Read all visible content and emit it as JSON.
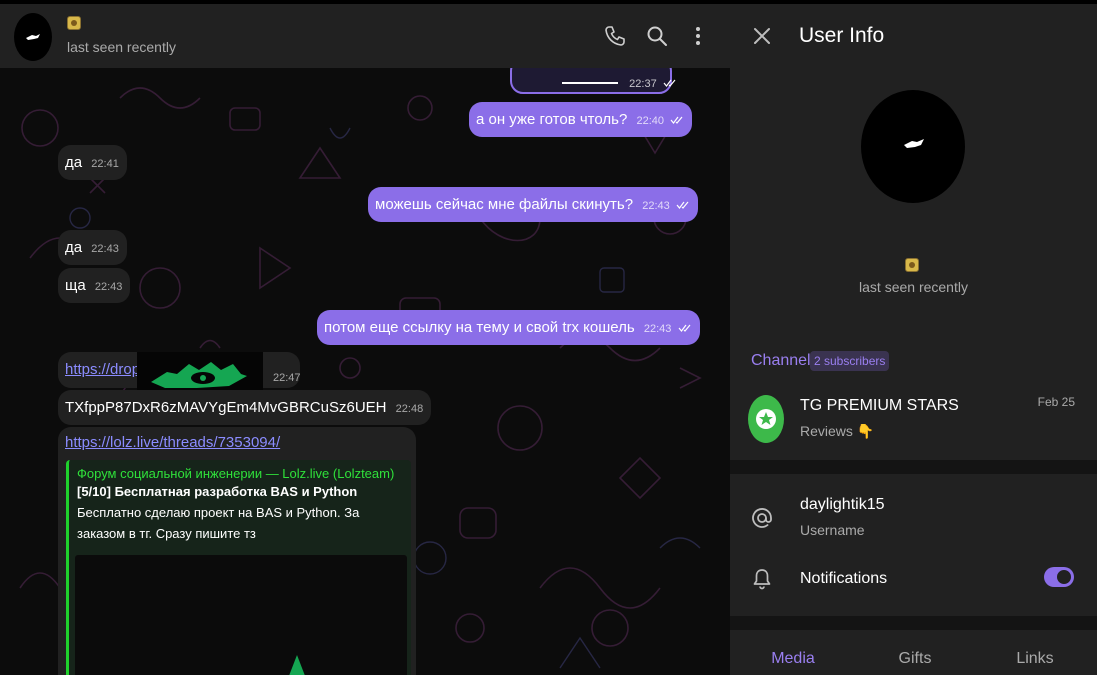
{
  "header": {
    "status": "last seen recently"
  },
  "messages": [
    {
      "dir": "out",
      "text": "",
      "time": "22:37"
    },
    {
      "dir": "out",
      "text": "а он уже готов чтоль?",
      "time": "22:40"
    },
    {
      "dir": "in",
      "text": "да",
      "time": "22:41"
    },
    {
      "dir": "out",
      "text": "можешь сейчас мне файлы скинуть?",
      "time": "22:43"
    },
    {
      "dir": "in",
      "text": "да",
      "time": "22:43"
    },
    {
      "dir": "in",
      "text": "ща",
      "time": "22:43"
    },
    {
      "dir": "out",
      "text": "потом еще ссылку на тему и свой trx кошель",
      "time": "22:43"
    },
    {
      "dir": "in",
      "text": "https://drop",
      "time": "22:47"
    },
    {
      "dir": "in",
      "text": "TXfppP87DxR6zMAVYgEm4MvGBRCuSz6UEH",
      "time": "22:48"
    },
    {
      "dir": "in",
      "text": "https://lolz.live/threads/7353094/",
      "time": ""
    }
  ],
  "link_preview": {
    "site": "Форум социальной инженерии —  Lolz.live (Lolzteam)",
    "title": "[5/10] Бесплатная разработка BAS и Python",
    "description": "Бесплатно сделаю проект на BAS и Python. За заказом в тг. Сразу пишите тз"
  },
  "info_panel": {
    "title": "User Info",
    "status": "last seen recently",
    "channel_label": "Channel",
    "channel_badge": "2 subscribers",
    "channel_name": "TG PREMIUM STARS",
    "channel_sub": "Reviews 👇",
    "channel_date": "Feb 25",
    "username": "daylightik15",
    "username_label": "Username",
    "notifications_label": "Notifications",
    "notifications_on": true,
    "tabs": [
      "Media",
      "Gifts",
      "Links"
    ],
    "active_tab": "Media"
  },
  "colors": {
    "accent": "#8b6ee8",
    "outgoing_bubble": "#8b6ee8",
    "incoming_bubble": "#212121",
    "preview_accent": "#1fd12c"
  }
}
